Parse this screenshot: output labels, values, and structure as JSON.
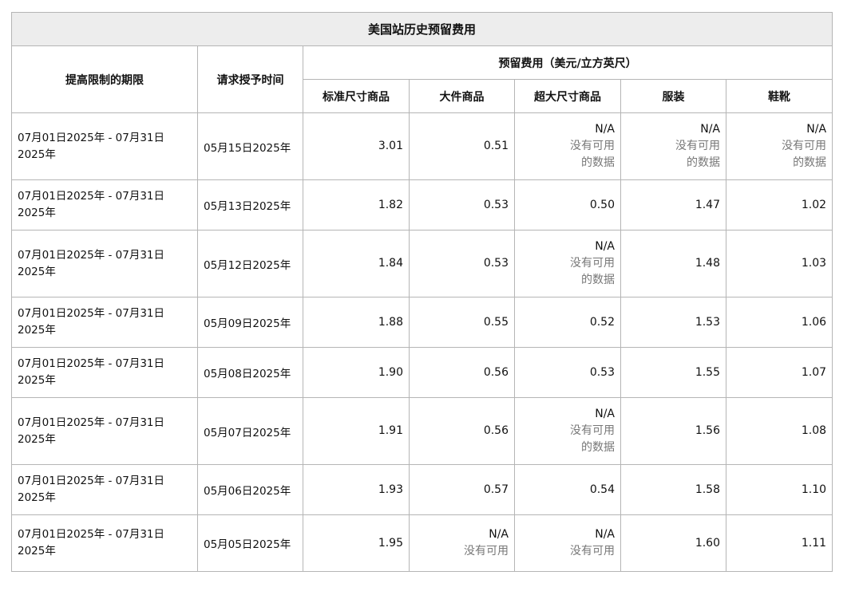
{
  "table": {
    "title": "美国站历史预留费用",
    "header_period": "提高限制的期限",
    "header_request": "请求授予时间",
    "header_group": "预留费用（美元/立方英尺）",
    "sub_headers": [
      "标准尺寸商品",
      "大件商品",
      "超大尺寸商品",
      "服装",
      "鞋靴"
    ],
    "na_label": "N/A",
    "na_sub_1": "没有可用",
    "na_sub_2": "的数据",
    "rows": [
      {
        "period_1": "07月01日2025年 - 07月31日",
        "period_2": "2025年",
        "date": "05月15日2025年",
        "v": [
          "3.01",
          "0.51",
          null,
          null,
          null
        ]
      },
      {
        "period_1": "07月01日2025年 - 07月31日",
        "period_2": "2025年",
        "date": "05月13日2025年",
        "v": [
          "1.82",
          "0.53",
          "0.50",
          "1.47",
          "1.02"
        ]
      },
      {
        "period_1": "07月01日2025年 - 07月31日",
        "period_2": "2025年",
        "date": "05月12日2025年",
        "v": [
          "1.84",
          "0.53",
          null,
          "1.48",
          "1.03"
        ]
      },
      {
        "period_1": "07月01日2025年 - 07月31日",
        "period_2": "2025年",
        "date": "05月09日2025年",
        "v": [
          "1.88",
          "0.55",
          "0.52",
          "1.53",
          "1.06"
        ]
      },
      {
        "period_1": "07月01日2025年 - 07月31日",
        "period_2": "2025年",
        "date": "05月08日2025年",
        "v": [
          "1.90",
          "0.56",
          "0.53",
          "1.55",
          "1.07"
        ]
      },
      {
        "period_1": "07月01日2025年 - 07月31日",
        "period_2": "2025年",
        "date": "05月07日2025年",
        "v": [
          "1.91",
          "0.56",
          null,
          "1.56",
          "1.08"
        ]
      },
      {
        "period_1": "07月01日2025年 - 07月31日",
        "period_2": "2025年",
        "date": "05月06日2025年",
        "v": [
          "1.93",
          "0.57",
          "0.54",
          "1.58",
          "1.10"
        ]
      },
      {
        "period_1": "07月01日2025年 - 07月31日",
        "period_2": "2025年",
        "date": "05月05日2025年",
        "v": [
          "1.95",
          null,
          null,
          "1.60",
          "1.11"
        ]
      }
    ]
  }
}
